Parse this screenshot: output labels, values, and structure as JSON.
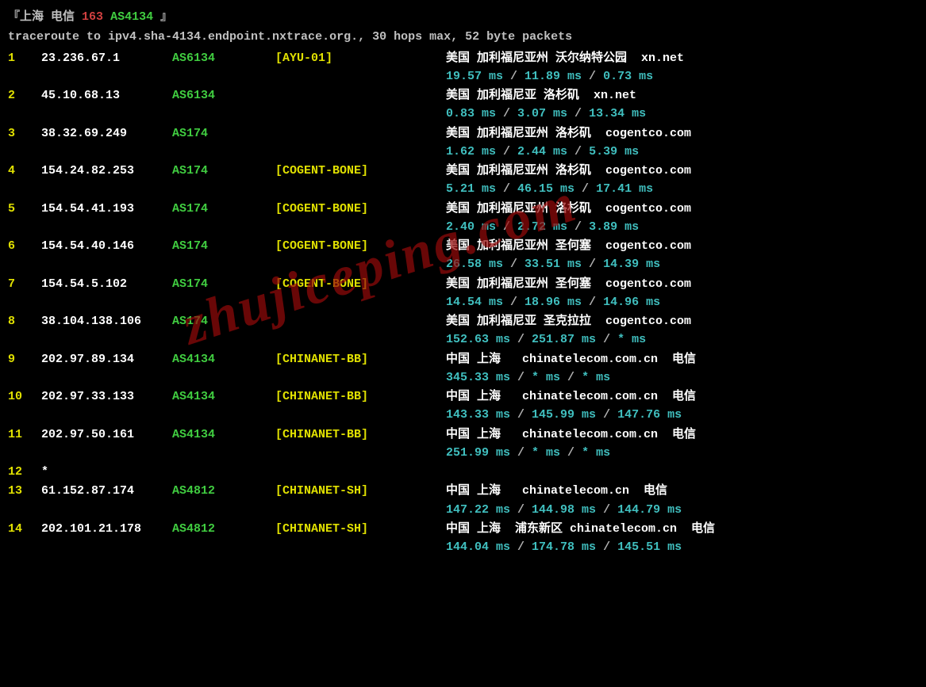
{
  "header": {
    "bracket_open": "『",
    "location": "上海 电信",
    "red163": "163",
    "asn": "AS4134",
    "bracket_close": "』"
  },
  "traceroute_line": "traceroute to ipv4.sha-4134.endpoint.nxtrace.org., 30 hops max, 52 byte packets",
  "watermark": "zhujiceping.com",
  "hops": [
    {
      "num": "1",
      "ip": "23.236.67.1",
      "asn": "AS6134",
      "asname": "[AYU-01]",
      "loc": "美国 加利福尼亚州 沃尔纳特公园  xn.net",
      "t1": "19.57 ms",
      "t2": "11.89 ms",
      "t3": "0.73 ms"
    },
    {
      "num": "2",
      "ip": "45.10.68.13",
      "asn": "AS6134",
      "asname": "",
      "loc": "美国 加利福尼亚 洛杉矶  xn.net",
      "t1": "0.83 ms",
      "t2": "3.07 ms",
      "t3": "13.34 ms"
    },
    {
      "num": "3",
      "ip": "38.32.69.249",
      "asn": "AS174",
      "asname": "",
      "loc": "美国 加利福尼亚州 洛杉矶  cogentco.com",
      "t1": "1.62 ms",
      "t2": "2.44 ms",
      "t3": "5.39 ms"
    },
    {
      "num": "4",
      "ip": "154.24.82.253",
      "asn": "AS174",
      "asname": "[COGENT-BONE]",
      "loc": "美国 加利福尼亚州 洛杉矶  cogentco.com",
      "t1": "5.21 ms",
      "t2": "46.15 ms",
      "t3": "17.41 ms"
    },
    {
      "num": "5",
      "ip": "154.54.41.193",
      "asn": "AS174",
      "asname": "[COGENT-BONE]",
      "loc": "美国 加利福尼亚州 洛杉矶  cogentco.com",
      "t1": "2.40 ms",
      "t2": "2.72 ms",
      "t3": "3.89 ms"
    },
    {
      "num": "6",
      "ip": "154.54.40.146",
      "asn": "AS174",
      "asname": "[COGENT-BONE]",
      "loc": "美国 加利福尼亚州 圣何塞  cogentco.com",
      "t1": "26.58 ms",
      "t2": "33.51 ms",
      "t3": "14.39 ms"
    },
    {
      "num": "7",
      "ip": "154.54.5.102",
      "asn": "AS174",
      "asname": "[COGENT-BONE]",
      "loc": "美国 加利福尼亚州 圣何塞  cogentco.com",
      "t1": "14.54 ms",
      "t2": "18.96 ms",
      "t3": "14.96 ms"
    },
    {
      "num": "8",
      "ip": "38.104.138.106",
      "asn": "AS174",
      "asname": "",
      "loc": "美国 加利福尼亚 圣克拉拉  cogentco.com",
      "t1": "152.63 ms",
      "t2": "251.87 ms",
      "t3": "* ms"
    },
    {
      "num": "9",
      "ip": "202.97.89.134",
      "asn": "AS4134",
      "asname": "[CHINANET-BB]",
      "loc": "中国 上海   chinatelecom.com.cn  电信",
      "t1": "345.33 ms",
      "t2": "* ms",
      "t3": "* ms"
    },
    {
      "num": "10",
      "ip": "202.97.33.133",
      "asn": "AS4134",
      "asname": "[CHINANET-BB]",
      "loc": "中国 上海   chinatelecom.com.cn  电信",
      "t1": "143.33 ms",
      "t2": "145.99 ms",
      "t3": "147.76 ms"
    },
    {
      "num": "11",
      "ip": "202.97.50.161",
      "asn": "AS4134",
      "asname": "[CHINANET-BB]",
      "loc": "中国 上海   chinatelecom.com.cn  电信",
      "t1": "251.99 ms",
      "t2": "* ms",
      "t3": "* ms"
    },
    {
      "num": "12",
      "ip": "*",
      "asn": "",
      "asname": "",
      "loc": "",
      "t1": "",
      "t2": "",
      "t3": "",
      "timeout": true
    },
    {
      "num": "13",
      "ip": "61.152.87.174",
      "asn": "AS4812",
      "asname": "[CHINANET-SH]",
      "loc": "中国 上海   chinatelecom.cn  电信",
      "t1": "147.22 ms",
      "t2": "144.98 ms",
      "t3": "144.79 ms"
    },
    {
      "num": "14",
      "ip": "202.101.21.178",
      "asn": "AS4812",
      "asname": "[CHINANET-SH]",
      "loc": "中国 上海  浦东新区 chinatelecom.cn  电信",
      "t1": "144.04 ms",
      "t2": "174.78 ms",
      "t3": "145.51 ms"
    }
  ]
}
